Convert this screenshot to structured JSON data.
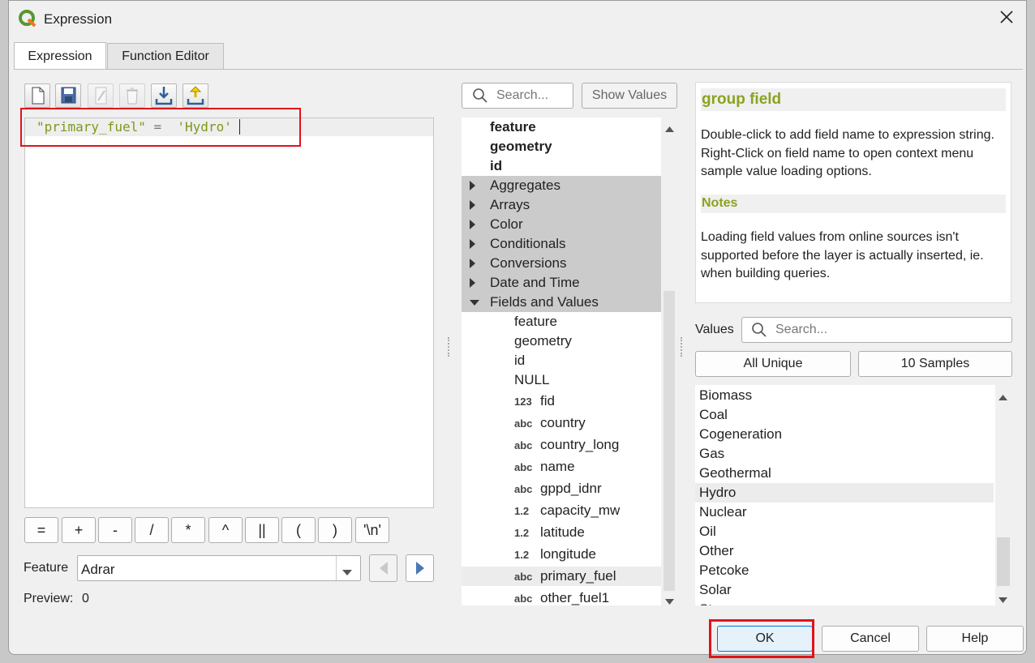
{
  "window": {
    "title": "Expression",
    "close_icon": "close-icon",
    "app_icon": "qgis-logo-icon"
  },
  "tabs": [
    {
      "label": "Expression",
      "active": true
    },
    {
      "label": "Function Editor",
      "active": false
    }
  ],
  "toolbar": [
    "new-file-icon",
    "save-icon",
    "edit-icon",
    "delete-icon",
    "import-icon",
    "export-icon"
  ],
  "editor": {
    "field": "\"primary_fuel\"",
    "operator": "=",
    "value": "'Hydro'"
  },
  "operators": [
    "=",
    "+",
    "-",
    "/",
    "*",
    "^",
    "||",
    "(",
    ")",
    "'\\n'"
  ],
  "feature": {
    "label": "Feature",
    "value": "Adrar"
  },
  "preview": {
    "label": "Preview:",
    "value": "0"
  },
  "search": {
    "placeholder": "Search...",
    "show_values": "Show Values"
  },
  "tree": {
    "top": [
      "feature",
      "geometry",
      "id"
    ],
    "groups": [
      "Aggregates",
      "Arrays",
      "Color",
      "Conditionals",
      "Conversions",
      "Date and Time",
      "Fields and Values"
    ],
    "fields": [
      {
        "type": "",
        "name": "feature"
      },
      {
        "type": "",
        "name": "geometry"
      },
      {
        "type": "",
        "name": "id"
      },
      {
        "type": "",
        "name": "NULL"
      },
      {
        "type": "123",
        "name": "fid"
      },
      {
        "type": "abc",
        "name": "country"
      },
      {
        "type": "abc",
        "name": "country_long"
      },
      {
        "type": "abc",
        "name": "name"
      },
      {
        "type": "abc",
        "name": "gppd_idnr"
      },
      {
        "type": "1.2",
        "name": "capacity_mw"
      },
      {
        "type": "1.2",
        "name": "latitude"
      },
      {
        "type": "1.2",
        "name": "longitude"
      },
      {
        "type": "abc",
        "name": "primary_fuel"
      },
      {
        "type": "abc",
        "name": "other_fuel1"
      }
    ]
  },
  "help": {
    "title": "group field",
    "body": "Double-click to add field name to expression string. Right-Click on field name to open context menu sample value loading options.",
    "notes_title": "Notes",
    "notes": "Loading field values from online sources isn't supported before the layer is actually inserted, ie. when building queries."
  },
  "values": {
    "label": "Values",
    "search_placeholder": "Search...",
    "all_unique": "All Unique",
    "samples": "10 Samples",
    "items": [
      "Biomass",
      "Coal",
      "Cogeneration",
      "Gas",
      "Geothermal",
      "Hydro",
      "Nuclear",
      "Oil",
      "Other",
      "Petcoke",
      "Solar",
      "St"
    ],
    "selected": "Hydro"
  },
  "buttons": {
    "ok": "OK",
    "cancel": "Cancel",
    "help": "Help"
  },
  "colors": {
    "accent_green": "#8aa320",
    "highlight_red": "#e0131c",
    "group_bg": "#cbcbcb"
  }
}
